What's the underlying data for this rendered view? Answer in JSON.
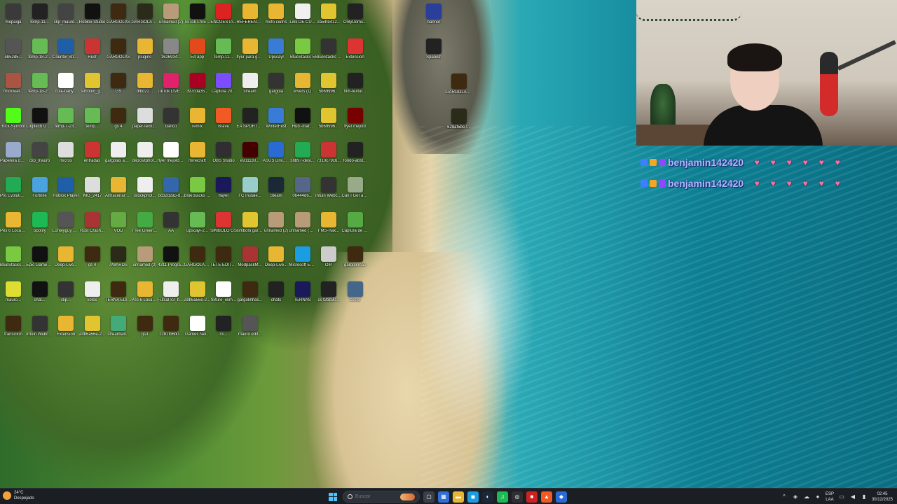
{
  "desktop": {
    "icons": [
      {
        "label": "mepaiga",
        "icon": "folder-icon",
        "color": "#3a3a3a"
      },
      {
        "label": "temp-11...",
        "icon": "image-icon",
        "color": "#222"
      },
      {
        "label": "clip_mauro...",
        "icon": "video-icon",
        "color": "#444"
      },
      {
        "label": "Roblox Studio",
        "icon": "roblox-icon",
        "color": "#111"
      },
      {
        "label": "GARGOLAS",
        "icon": "image-icon",
        "color": "#3d2a10"
      },
      {
        "label": "GARGOLAS AWARDS",
        "icon": "image-icon",
        "color": "#2b2b1a"
      },
      {
        "label": "unnamed (2)",
        "icon": "envelope-icon",
        "color": "#b89c7a"
      },
      {
        "label": "TikTok LIVE Studio",
        "icon": "tiktok-icon",
        "color": "#111"
      },
      {
        "label": "ENCUESTA...",
        "icon": "pdf-icon",
        "color": "#d22"
      },
      {
        "label": "REFERENCIAS",
        "icon": "folder-icon",
        "color": "#e8b632"
      },
      {
        "label": "mofo ciutris",
        "icon": "folder-icon",
        "color": "#e8b632"
      },
      {
        "label": "Link DE CU...",
        "icon": "file-icon",
        "color": "#f0f0f0"
      },
      {
        "label": "2a54fe412...",
        "icon": "badge-icon",
        "color": "#e0c430"
      },
      {
        "label": "OnlyDoms...",
        "icon": "app-icon",
        "color": "#222"
      },
      {
        "label": "eb52d5...",
        "icon": "image-icon",
        "color": "#555"
      },
      {
        "label": "temp-18-2...",
        "icon": "image-icon",
        "color": "#6b5"
      },
      {
        "label": "Counter Strike 2",
        "icon": "cs2-icon",
        "color": "#1f5fa8"
      },
      {
        "label": "Rust",
        "icon": "rust-icon",
        "color": "#c33"
      },
      {
        "label": "GARGOLAS",
        "icon": "image-icon",
        "color": "#3d2a10"
      },
      {
        "label": "plugins",
        "icon": "folder-icon",
        "color": "#e8b632"
      },
      {
        "label": "1626934...",
        "icon": "file-icon",
        "color": "#888"
      },
      {
        "label": "EA app",
        "icon": "ea-icon",
        "color": "#e24a1c"
      },
      {
        "label": "temp-11...",
        "icon": "image-icon",
        "color": "#6b5"
      },
      {
        "label": "flyer para gargola",
        "icon": "folder-icon",
        "color": "#e8b632"
      },
      {
        "label": "Upscayl",
        "icon": "app-icon",
        "color": "#3a7bd5"
      },
      {
        "label": "BlueStacks 5",
        "icon": "bluestacks-icon",
        "color": "#7ac943"
      },
      {
        "label": "BlueStacks 5 Multi...",
        "icon": "bluestacks-icon",
        "color": "#333"
      },
      {
        "label": "Extension",
        "icon": "app-icon",
        "color": "#d33"
      },
      {
        "label": "brickwall...",
        "icon": "image-icon",
        "color": "#a54"
      },
      {
        "label": "temp-18-2...",
        "icon": "image-icon",
        "color": "#6b5"
      },
      {
        "label": "cute-baby...",
        "icon": "image-icon",
        "color": "#fff"
      },
      {
        "label": "simbolo_g...",
        "icon": "badge-icon",
        "color": "#e0c430"
      },
      {
        "label": "GS",
        "icon": "image-icon",
        "color": "#3d2a10"
      },
      {
        "label": "dfbd22...",
        "icon": "folder-icon",
        "color": "#e8b632"
      },
      {
        "label": "TikTok LIVE Studio",
        "icon": "tiktok-icon",
        "color": "#e0226a"
      },
      {
        "label": "397cda35...",
        "icon": "file-icon",
        "color": "#a02"
      },
      {
        "label": "Captura 20...",
        "icon": "app-icon",
        "color": "#7b4dff"
      },
      {
        "label": "stream",
        "icon": "file-icon",
        "color": "#eee"
      },
      {
        "label": "gargola",
        "icon": "image-icon",
        "color": "#333"
      },
      {
        "label": "ervers (1)",
        "icon": "folder-icon",
        "color": "#e8b632"
      },
      {
        "label": "5b69996...",
        "icon": "badge-icon",
        "color": "#e0c430"
      },
      {
        "label": "film-textur...",
        "icon": "image-icon",
        "color": "#222"
      },
      {
        "label": "Kick-Symbol",
        "icon": "kick-icon",
        "color": "#53fc18"
      },
      {
        "label": "Logitech G HUB",
        "icon": "logitech-icon",
        "color": "#111"
      },
      {
        "label": "temp-7-23...",
        "icon": "image-icon",
        "color": "#6b5"
      },
      {
        "label": "temp...",
        "icon": "image-icon",
        "color": "#6b5"
      },
      {
        "label": "gs 4",
        "icon": "image-icon",
        "color": "#3d2a10"
      },
      {
        "label": "paper-textu...",
        "icon": "image-icon",
        "color": "#ddd"
      },
      {
        "label": "banco",
        "icon": "image-icon",
        "color": "#333"
      },
      {
        "label": "remix",
        "icon": "folder-icon",
        "color": "#e8b632"
      },
      {
        "label": "Brave",
        "icon": "brave-icon",
        "color": "#f15a24"
      },
      {
        "label": "EA SPORTS FC 25",
        "icon": "app-icon",
        "color": "#222"
      },
      {
        "label": "WinterFest",
        "icon": "app-icon",
        "color": "#3a7bd5"
      },
      {
        "label": "Hub -mar...",
        "icon": "logitech-icon",
        "color": "#111"
      },
      {
        "label": "5b69996...",
        "icon": "badge-icon",
        "color": "#e0c430"
      },
      {
        "label": "flyer mejold",
        "icon": "image-icon",
        "color": "#700"
      },
      {
        "label": "Papelera de reciclaje",
        "icon": "recycle-bin-icon",
        "color": "#9ac"
      },
      {
        "label": "clip_mauro",
        "icon": "video-icon",
        "color": "#444"
      },
      {
        "label": "micros",
        "icon": "image-icon",
        "color": "#ddd"
      },
      {
        "label": "entradas",
        "icon": "image-icon",
        "color": "#c33"
      },
      {
        "label": "gargolas awards",
        "icon": "file-icon",
        "color": "#eee"
      },
      {
        "label": "depositphot...",
        "icon": "image-icon",
        "color": "#eee"
      },
      {
        "label": "flyer mejold caffera",
        "icon": "file-icon",
        "color": "#fff"
      },
      {
        "label": "minecraft",
        "icon": "folder-icon",
        "color": "#e8b632"
      },
      {
        "label": "OBS Studio",
        "icon": "obs-icon",
        "color": "#302e31"
      },
      {
        "label": "e911130...",
        "icon": "image-icon",
        "color": "#400"
      },
      {
        "label": "ASUS DriveHub",
        "icon": "app-icon",
        "color": "#2a6ad3"
      },
      {
        "label": "38b97-desi...",
        "icon": "image-icon",
        "color": "#2a5"
      },
      {
        "label": "7310c79c6...",
        "icon": "image-icon",
        "color": "#c33"
      },
      {
        "label": "fondo-abst...",
        "icon": "image-icon",
        "color": "#222"
      },
      {
        "label": "Pro Evolution Soccer 6",
        "icon": "app-icon",
        "color": "#2a5"
      },
      {
        "label": "Fortnite",
        "icon": "app-icon",
        "color": "#4aa3df"
      },
      {
        "label": "Roblox Player",
        "icon": "roblox-icon",
        "color": "#1f5fa8"
      },
      {
        "label": "IMG_2417",
        "icon": "image-icon",
        "color": "#ddd"
      },
      {
        "label": "Almacenar automatic...",
        "icon": "folder-icon",
        "color": "#e8b632"
      },
      {
        "label": "istockphot...",
        "icon": "image-icon",
        "color": "#eee"
      },
      {
        "label": "bcb2d2a5-8...",
        "icon": "image-icon",
        "color": "#36a"
      },
      {
        "label": "BlueStacks Multi-Insta...",
        "icon": "bluestacks-icon",
        "color": "#7ac943"
      },
      {
        "label": "flayer",
        "icon": "ae-icon",
        "color": "#1a1a5a"
      },
      {
        "label": "FC Instale...",
        "icon": "app-icon",
        "color": "#9cc"
      },
      {
        "label": "Steam",
        "icon": "steam-icon",
        "color": "#1b2838"
      },
      {
        "label": "06444d6...",
        "icon": "image-icon",
        "color": "#568"
      },
      {
        "label": "Intuin Webcam",
        "icon": "app-icon",
        "color": "#333"
      },
      {
        "label": "Can I Get a Kiss Mauroo",
        "icon": "image-icon",
        "color": "#9a8"
      },
      {
        "label": "Pes 6 Locazos",
        "icon": "folder-icon",
        "color": "#e8b632"
      },
      {
        "label": "Spotify",
        "icon": "spotify-icon",
        "color": "#1db954"
      },
      {
        "label": "Lonelyguy Video (2)",
        "icon": "video-icon",
        "color": "#555"
      },
      {
        "label": "Rust Crash...",
        "icon": "app-icon",
        "color": "#a33"
      },
      {
        "label": "VOD",
        "icon": "app-icon",
        "color": "#6a4"
      },
      {
        "label": "Free Green...",
        "icon": "image-icon",
        "color": "#4a4"
      },
      {
        "label": "AA",
        "icon": "image-icon",
        "color": "#333"
      },
      {
        "label": "upscayl-2...",
        "icon": "image-icon",
        "color": "#6b5"
      },
      {
        "label": "SIMBOLO GS",
        "icon": "badge-icon",
        "color": "#d33"
      },
      {
        "label": "simbolo gargola...",
        "icon": "badge-icon",
        "color": "#e0c430"
      },
      {
        "label": "unnamed (2)",
        "icon": "envelope-icon",
        "color": "#b89c7a"
      },
      {
        "label": "unnamed (2) gargola",
        "icon": "envelope-icon",
        "color": "#b89c7a"
      },
      {
        "label": "FMS-Hax...",
        "icon": "folder-icon",
        "color": "#e8b632"
      },
      {
        "label": "Captura de pantalla ...",
        "icon": "image-icon",
        "color": "#5a4"
      },
      {
        "label": "BlueStacksL...",
        "icon": "bluestacks-icon",
        "color": "#7ac943"
      },
      {
        "label": "Epic Games Launcher",
        "icon": "epic-icon",
        "color": "#111"
      },
      {
        "label": "Deep-Live...",
        "icon": "folder-icon",
        "color": "#e8b632"
      },
      {
        "label": "gs 4",
        "icon": "image-icon",
        "color": "#3d2a10"
      },
      {
        "label": "AWARDS",
        "icon": "image-icon",
        "color": "#2b2b1a"
      },
      {
        "label": "unnamed (2)",
        "icon": "envelope-icon",
        "color": "#b89c7a"
      },
      {
        "label": "4311 Progra...",
        "icon": "image-icon",
        "color": "#111"
      },
      {
        "label": "GARGOLAS AWARDS",
        "icon": "image-icon",
        "color": "#3d2a10"
      },
      {
        "label": "TETE EDITOR",
        "icon": "image-icon",
        "color": "#3d2a10"
      },
      {
        "label": "ModpackM...",
        "icon": "app-icon",
        "color": "#a33"
      },
      {
        "label": "Deep-Live...",
        "icon": "folder-icon",
        "color": "#e8b632"
      },
      {
        "label": "Microsoft Edge",
        "icon": "edge-icon",
        "color": "#1b9de2"
      },
      {
        "label": "OIP",
        "icon": "image-icon",
        "color": "#ccc"
      },
      {
        "label": "gargolinhas",
        "icon": "image-icon",
        "color": "#3d2a10"
      },
      {
        "label": "mauro...",
        "icon": "image-icon",
        "color": "#dd3"
      },
      {
        "label": "chat...",
        "icon": "image-icon",
        "color": "#111"
      },
      {
        "label": "clip...",
        "icon": "image-icon",
        "color": "#333"
      },
      {
        "label": "votos",
        "icon": "file-icon",
        "color": "#eee"
      },
      {
        "label": "TERNA EDITOR...",
        "icon": "image-icon",
        "color": "#3d2a10"
      },
      {
        "label": "Pes 6 Locazos",
        "icon": "folder-icon",
        "color": "#e8b632"
      },
      {
        "label": "Futsal x3_by Bazinga fro...",
        "icon": "file-icon",
        "color": "#eee"
      },
      {
        "label": "a9b6a56e-2...",
        "icon": "badge-icon",
        "color": "#e0c430"
      },
      {
        "label": "fixture_elim...",
        "icon": "file-icon",
        "color": "#fff"
      },
      {
        "label": "gargolinhas...",
        "icon": "image-icon",
        "color": "#3d2a10"
      },
      {
        "label": "chats",
        "icon": "image-icon",
        "color": "#222"
      },
      {
        "label": "TERNAS",
        "icon": "ae-icon",
        "color": "#1a1a5a"
      },
      {
        "label": "cs t2bb30...",
        "icon": "image-icon",
        "color": "#222"
      },
      {
        "label": "cesto",
        "icon": "image-icon",
        "color": "#468"
      },
      {
        "label": "transicion",
        "icon": "image-icon",
        "color": "#3d2a10"
      },
      {
        "label": "Intuin Webcam",
        "icon": "app-icon",
        "color": "#333"
      },
      {
        "label": "Extension",
        "icon": "folder-icon",
        "color": "#e8b632"
      },
      {
        "label": "a9b6a56e-2...",
        "icon": "badge-icon",
        "color": "#e0c430"
      },
      {
        "label": "streamlab...",
        "icon": "image-icon",
        "color": "#4a7"
      },
      {
        "label": "gs3",
        "icon": "image-icon",
        "color": "#3d2a10"
      },
      {
        "label": "c2b1fb6b0...",
        "icon": "image-icon",
        "color": "#3d2a10"
      },
      {
        "label": "Games Nel...",
        "icon": "app-icon",
        "color": "#fff"
      },
      {
        "label": "cs...",
        "icon": "image-icon",
        "color": "#222"
      },
      {
        "label": "mauro edit...",
        "icon": "image-icon",
        "color": "#555"
      }
    ]
  },
  "webcam": {
    "label": ""
  },
  "chat": {
    "alerts": [
      {
        "username": "benjamin142420",
        "hearts": 6
      },
      {
        "username": "benjamin142420",
        "hearts": 6
      }
    ]
  },
  "taskbar": {
    "weather_temp": "24°C",
    "weather_desc": "Despejado",
    "search_placeholder": "Buscar",
    "apps": [
      {
        "name": "task-view-icon",
        "color": "#3a3f47",
        "glyph": "▢"
      },
      {
        "name": "widgets-icon",
        "color": "#2f6fd6",
        "glyph": "▦"
      },
      {
        "name": "file-explorer-icon",
        "color": "#e8b632",
        "glyph": "▬"
      },
      {
        "name": "edge-icon",
        "color": "#1b9de2",
        "glyph": "◉"
      },
      {
        "name": "steam-icon",
        "color": "#1b2838",
        "glyph": "◐"
      },
      {
        "name": "spotify-icon",
        "color": "#1db954",
        "glyph": "♫"
      },
      {
        "name": "obs-icon",
        "color": "#302e31",
        "glyph": "◎"
      },
      {
        "name": "recording-icon",
        "color": "#c22",
        "glyph": "■"
      },
      {
        "name": "brave-icon",
        "color": "#f15a24",
        "glyph": "▲"
      },
      {
        "name": "misc-app-icon",
        "color": "#2a6ad3",
        "glyph": "◆"
      }
    ],
    "lang_top": "ESP",
    "lang_bottom": "LAA",
    "time": "02:45",
    "date": "30/12/2025"
  }
}
